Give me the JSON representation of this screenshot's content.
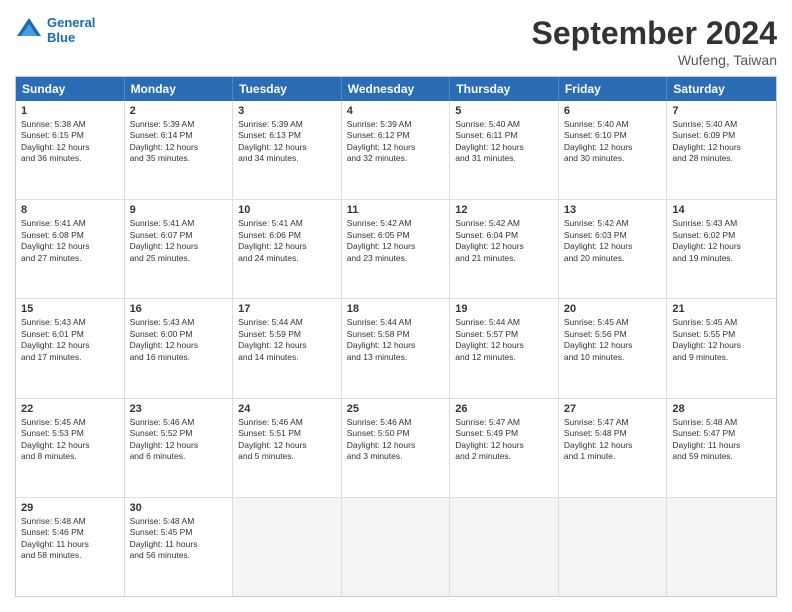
{
  "header": {
    "logo_line1": "General",
    "logo_line2": "Blue",
    "month_title": "September 2024",
    "location": "Wufeng, Taiwan"
  },
  "weekdays": [
    "Sunday",
    "Monday",
    "Tuesday",
    "Wednesday",
    "Thursday",
    "Friday",
    "Saturday"
  ],
  "rows": [
    [
      {
        "day": "",
        "empty": true
      },
      {
        "day": "",
        "empty": true
      },
      {
        "day": "",
        "empty": true
      },
      {
        "day": "",
        "empty": true
      },
      {
        "day": "",
        "empty": true
      },
      {
        "day": "",
        "empty": true
      },
      {
        "day": "",
        "empty": true
      }
    ],
    [
      {
        "day": "1",
        "lines": [
          "Sunrise: 5:38 AM",
          "Sunset: 6:15 PM",
          "Daylight: 12 hours",
          "and 36 minutes."
        ]
      },
      {
        "day": "2",
        "lines": [
          "Sunrise: 5:39 AM",
          "Sunset: 6:14 PM",
          "Daylight: 12 hours",
          "and 35 minutes."
        ]
      },
      {
        "day": "3",
        "lines": [
          "Sunrise: 5:39 AM",
          "Sunset: 6:13 PM",
          "Daylight: 12 hours",
          "and 34 minutes."
        ]
      },
      {
        "day": "4",
        "lines": [
          "Sunrise: 5:39 AM",
          "Sunset: 6:12 PM",
          "Daylight: 12 hours",
          "and 32 minutes."
        ]
      },
      {
        "day": "5",
        "lines": [
          "Sunrise: 5:40 AM",
          "Sunset: 6:11 PM",
          "Daylight: 12 hours",
          "and 31 minutes."
        ]
      },
      {
        "day": "6",
        "lines": [
          "Sunrise: 5:40 AM",
          "Sunset: 6:10 PM",
          "Daylight: 12 hours",
          "and 30 minutes."
        ]
      },
      {
        "day": "7",
        "lines": [
          "Sunrise: 5:40 AM",
          "Sunset: 6:09 PM",
          "Daylight: 12 hours",
          "and 28 minutes."
        ]
      }
    ],
    [
      {
        "day": "8",
        "lines": [
          "Sunrise: 5:41 AM",
          "Sunset: 6:08 PM",
          "Daylight: 12 hours",
          "and 27 minutes."
        ]
      },
      {
        "day": "9",
        "lines": [
          "Sunrise: 5:41 AM",
          "Sunset: 6:07 PM",
          "Daylight: 12 hours",
          "and 25 minutes."
        ]
      },
      {
        "day": "10",
        "lines": [
          "Sunrise: 5:41 AM",
          "Sunset: 6:06 PM",
          "Daylight: 12 hours",
          "and 24 minutes."
        ]
      },
      {
        "day": "11",
        "lines": [
          "Sunrise: 5:42 AM",
          "Sunset: 6:05 PM",
          "Daylight: 12 hours",
          "and 23 minutes."
        ]
      },
      {
        "day": "12",
        "lines": [
          "Sunrise: 5:42 AM",
          "Sunset: 6:04 PM",
          "Daylight: 12 hours",
          "and 21 minutes."
        ]
      },
      {
        "day": "13",
        "lines": [
          "Sunrise: 5:42 AM",
          "Sunset: 6:03 PM",
          "Daylight: 12 hours",
          "and 20 minutes."
        ]
      },
      {
        "day": "14",
        "lines": [
          "Sunrise: 5:43 AM",
          "Sunset: 6:02 PM",
          "Daylight: 12 hours",
          "and 19 minutes."
        ]
      }
    ],
    [
      {
        "day": "15",
        "lines": [
          "Sunrise: 5:43 AM",
          "Sunset: 6:01 PM",
          "Daylight: 12 hours",
          "and 17 minutes."
        ]
      },
      {
        "day": "16",
        "lines": [
          "Sunrise: 5:43 AM",
          "Sunset: 6:00 PM",
          "Daylight: 12 hours",
          "and 16 minutes."
        ]
      },
      {
        "day": "17",
        "lines": [
          "Sunrise: 5:44 AM",
          "Sunset: 5:59 PM",
          "Daylight: 12 hours",
          "and 14 minutes."
        ]
      },
      {
        "day": "18",
        "lines": [
          "Sunrise: 5:44 AM",
          "Sunset: 5:58 PM",
          "Daylight: 12 hours",
          "and 13 minutes."
        ]
      },
      {
        "day": "19",
        "lines": [
          "Sunrise: 5:44 AM",
          "Sunset: 5:57 PM",
          "Daylight: 12 hours",
          "and 12 minutes."
        ]
      },
      {
        "day": "20",
        "lines": [
          "Sunrise: 5:45 AM",
          "Sunset: 5:56 PM",
          "Daylight: 12 hours",
          "and 10 minutes."
        ]
      },
      {
        "day": "21",
        "lines": [
          "Sunrise: 5:45 AM",
          "Sunset: 5:55 PM",
          "Daylight: 12 hours",
          "and 9 minutes."
        ]
      }
    ],
    [
      {
        "day": "22",
        "lines": [
          "Sunrise: 5:45 AM",
          "Sunset: 5:53 PM",
          "Daylight: 12 hours",
          "and 8 minutes."
        ]
      },
      {
        "day": "23",
        "lines": [
          "Sunrise: 5:46 AM",
          "Sunset: 5:52 PM",
          "Daylight: 12 hours",
          "and 6 minutes."
        ]
      },
      {
        "day": "24",
        "lines": [
          "Sunrise: 5:46 AM",
          "Sunset: 5:51 PM",
          "Daylight: 12 hours",
          "and 5 minutes."
        ]
      },
      {
        "day": "25",
        "lines": [
          "Sunrise: 5:46 AM",
          "Sunset: 5:50 PM",
          "Daylight: 12 hours",
          "and 3 minutes."
        ]
      },
      {
        "day": "26",
        "lines": [
          "Sunrise: 5:47 AM",
          "Sunset: 5:49 PM",
          "Daylight: 12 hours",
          "and 2 minutes."
        ]
      },
      {
        "day": "27",
        "lines": [
          "Sunrise: 5:47 AM",
          "Sunset: 5:48 PM",
          "Daylight: 12 hours",
          "and 1 minute."
        ]
      },
      {
        "day": "28",
        "lines": [
          "Sunrise: 5:48 AM",
          "Sunset: 5:47 PM",
          "Daylight: 11 hours",
          "and 59 minutes."
        ]
      }
    ],
    [
      {
        "day": "29",
        "lines": [
          "Sunrise: 5:48 AM",
          "Sunset: 5:46 PM",
          "Daylight: 11 hours",
          "and 58 minutes."
        ]
      },
      {
        "day": "30",
        "lines": [
          "Sunrise: 5:48 AM",
          "Sunset: 5:45 PM",
          "Daylight: 11 hours",
          "and 56 minutes."
        ]
      },
      {
        "day": "",
        "empty": true
      },
      {
        "day": "",
        "empty": true
      },
      {
        "day": "",
        "empty": true
      },
      {
        "day": "",
        "empty": true
      },
      {
        "day": "",
        "empty": true
      }
    ]
  ]
}
